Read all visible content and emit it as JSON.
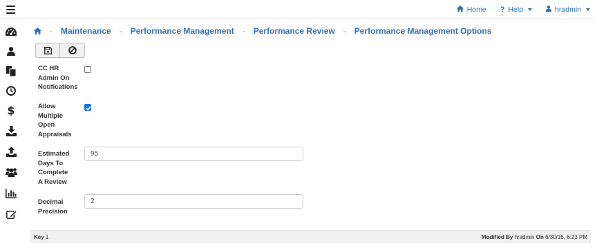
{
  "topnav": {
    "home_label": "Home",
    "help_label": "Help",
    "user_label": "hradmin"
  },
  "sidebar": {
    "icons": [
      "dashboard-icon",
      "user-icon",
      "documents-icon",
      "clock-icon",
      "dollar-icon",
      "download-icon",
      "upload-icon",
      "users-group-icon",
      "bar-chart-icon",
      "edit-icon"
    ]
  },
  "breadcrumb": {
    "items": [
      "Maintenance",
      "Performance Management",
      "Performance Review",
      "Performance Management Options"
    ],
    "separator": "-"
  },
  "form": {
    "cc_hr_admin": {
      "label_lines": [
        "CC HR",
        "Admin On",
        "Notifications"
      ],
      "checked": false
    },
    "allow_multiple": {
      "label_lines": [
        "Allow",
        "Multiple",
        "Open",
        "Appraisals"
      ],
      "checked": true
    },
    "estimated_days": {
      "label_lines": [
        "Estimated",
        "Days To",
        "Complete",
        "A Review"
      ],
      "value": "95"
    },
    "decimal_precision": {
      "label_lines": [
        "Decimal",
        "Precision"
      ],
      "value": "2"
    }
  },
  "footer": {
    "key_label": "Key",
    "key_value": "1",
    "modified_by_label": "Modified By",
    "modified_by_value": "hradmin",
    "on_label": "On",
    "on_value": "6/30/16, 6:23 PM"
  },
  "colors": {
    "link": "#2f6fae",
    "checkbox_checked": "#1a73e8"
  }
}
